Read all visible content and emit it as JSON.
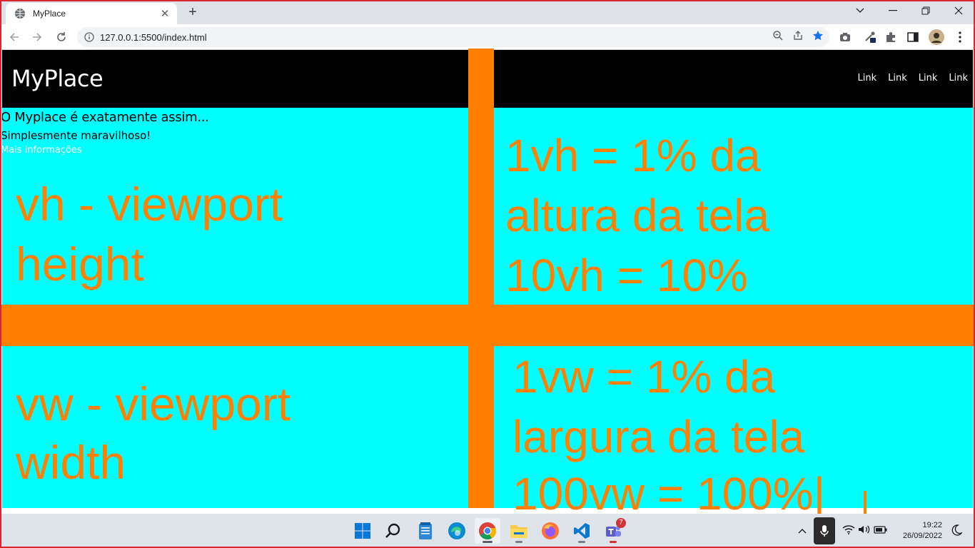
{
  "browser": {
    "tab_title": "MyPlace",
    "url": "127.0.0.1:5500/index.html",
    "new_tab_label": "+"
  },
  "site": {
    "brand": "MyPlace",
    "nav_links": [
      "Link",
      "Link",
      "Link",
      "Link"
    ],
    "hero_title": "O Myplace é exatamente assim...",
    "hero_subtitle": "Simplesmente maravilhoso!",
    "hero_link": "Mais informações"
  },
  "annotations": {
    "vh_title_line1": "vh - viewport",
    "vh_title_line2": "height",
    "vh_desc_line1": "1vh = 1% da",
    "vh_desc_line2": "altura da tela",
    "vh_desc_line3": "10vh = 10%",
    "vw_title_line1": "vw - viewport",
    "vw_title_line2": "width",
    "vw_desc_line1": "1vw = 1% da",
    "vw_desc_line2": "largura da tela",
    "vw_desc_line3": "100vw = 100%|"
  },
  "taskbar": {
    "apps": [
      "start-icon",
      "search-icon",
      "notepad-icon",
      "edge-icon",
      "chrome-icon",
      "file-explorer-icon",
      "firefox-icon",
      "vscode-icon",
      "teams-icon"
    ],
    "teams_badge": "7",
    "time": "19:22",
    "date": "26/09/2022"
  },
  "colors": {
    "accent_orange": "#ff7f00",
    "hero_bg": "#00ffff",
    "header_bg": "#000000",
    "frame_border": "#d7262f"
  }
}
